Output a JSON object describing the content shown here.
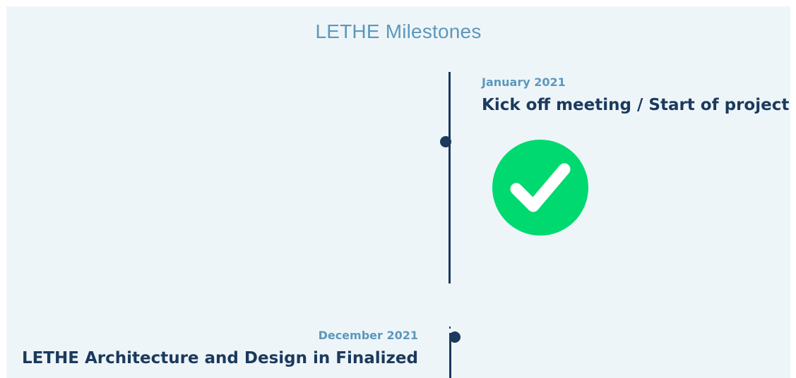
{
  "page": {
    "title": "LETHE Milestones"
  },
  "milestones": [
    {
      "date": "January 2021",
      "title": "Kick off meeting / Start of project",
      "side": "right",
      "status": "completed",
      "status_icon": "check-circle-icon",
      "status_color": "#00d96f"
    },
    {
      "date": "December 2021",
      "title": "LETHE Architecture and Design in Finalized",
      "side": "left"
    }
  ],
  "colors": {
    "background": "#eef5f9",
    "title": "#5c98bb",
    "date": "#5c98bb",
    "milestone_title": "#1b3a5c",
    "timeline": "#1b3a5c",
    "check_badge": "#00d96f"
  }
}
